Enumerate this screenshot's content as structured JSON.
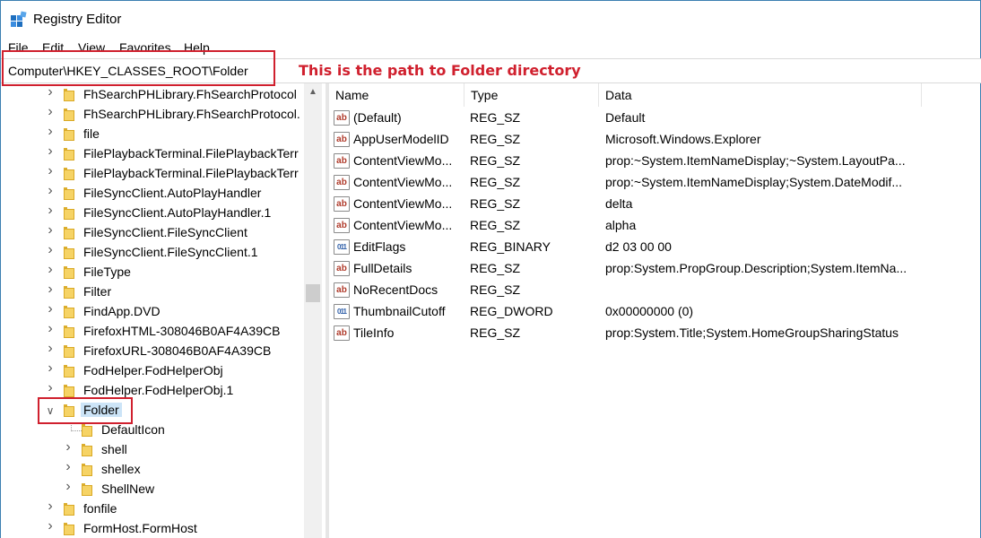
{
  "window": {
    "title": "Registry Editor"
  },
  "menu": [
    "File",
    "Edit",
    "View",
    "Favorites",
    "Help"
  ],
  "address": {
    "path": "Computer\\HKEY_CLASSES_ROOT\\Folder"
  },
  "annotation": "This is the path to Folder directory",
  "tree": [
    {
      "label": "FhSearchPHLibrary.FhSearchProtocol",
      "expanded": false,
      "level": 0
    },
    {
      "label": "FhSearchPHLibrary.FhSearchProtocol.",
      "expanded": false,
      "level": 0
    },
    {
      "label": "file",
      "expanded": false,
      "level": 0
    },
    {
      "label": "FilePlaybackTerminal.FilePlaybackTerr",
      "expanded": false,
      "level": 0
    },
    {
      "label": "FilePlaybackTerminal.FilePlaybackTerr",
      "expanded": false,
      "level": 0
    },
    {
      "label": "FileSyncClient.AutoPlayHandler",
      "expanded": false,
      "level": 0
    },
    {
      "label": "FileSyncClient.AutoPlayHandler.1",
      "expanded": false,
      "level": 0
    },
    {
      "label": "FileSyncClient.FileSyncClient",
      "expanded": false,
      "level": 0
    },
    {
      "label": "FileSyncClient.FileSyncClient.1",
      "expanded": false,
      "level": 0
    },
    {
      "label": "FileType",
      "expanded": false,
      "level": 0
    },
    {
      "label": "Filter",
      "expanded": false,
      "level": 0
    },
    {
      "label": "FindApp.DVD",
      "expanded": false,
      "level": 0
    },
    {
      "label": "FirefoxHTML-308046B0AF4A39CB",
      "expanded": false,
      "level": 0
    },
    {
      "label": "FirefoxURL-308046B0AF4A39CB",
      "expanded": false,
      "level": 0
    },
    {
      "label": "FodHelper.FodHelperObj",
      "expanded": false,
      "level": 0
    },
    {
      "label": "FodHelper.FodHelperObj.1",
      "expanded": false,
      "level": 0
    },
    {
      "label": "Folder",
      "expanded": true,
      "level": 0,
      "selected": true
    },
    {
      "label": "DefaultIcon",
      "expanded": null,
      "level": 1
    },
    {
      "label": "shell",
      "expanded": false,
      "level": 1
    },
    {
      "label": "shellex",
      "expanded": false,
      "level": 1
    },
    {
      "label": "ShellNew",
      "expanded": false,
      "level": 1
    },
    {
      "label": "fonfile",
      "expanded": false,
      "level": 0
    },
    {
      "label": "FormHost.FormHost",
      "expanded": false,
      "level": 0
    }
  ],
  "columns": {
    "name": "Name",
    "type": "Type",
    "data": "Data"
  },
  "values": [
    {
      "icon": "string-value-icon",
      "name": "(Default)",
      "type": "REG_SZ",
      "data": "Default"
    },
    {
      "icon": "string-value-icon",
      "name": "AppUserModelID",
      "type": "REG_SZ",
      "data": "Microsoft.Windows.Explorer"
    },
    {
      "icon": "string-value-icon",
      "name": "ContentViewMo...",
      "type": "REG_SZ",
      "data": "prop:~System.ItemNameDisplay;~System.LayoutPa..."
    },
    {
      "icon": "string-value-icon",
      "name": "ContentViewMo...",
      "type": "REG_SZ",
      "data": "prop:~System.ItemNameDisplay;System.DateModif..."
    },
    {
      "icon": "string-value-icon",
      "name": "ContentViewMo...",
      "type": "REG_SZ",
      "data": "delta"
    },
    {
      "icon": "string-value-icon",
      "name": "ContentViewMo...",
      "type": "REG_SZ",
      "data": "alpha"
    },
    {
      "icon": "binary-value-icon",
      "name": "EditFlags",
      "type": "REG_BINARY",
      "data": "d2 03 00 00"
    },
    {
      "icon": "string-value-icon",
      "name": "FullDetails",
      "type": "REG_SZ",
      "data": "prop:System.PropGroup.Description;System.ItemNa..."
    },
    {
      "icon": "string-value-icon",
      "name": "NoRecentDocs",
      "type": "REG_SZ",
      "data": ""
    },
    {
      "icon": "binary-value-icon",
      "name": "ThumbnailCutoff",
      "type": "REG_DWORD",
      "data": "0x00000000 (0)"
    },
    {
      "icon": "string-value-icon",
      "name": "TileInfo",
      "type": "REG_SZ",
      "data": "prop:System.Title;System.HomeGroupSharingStatus"
    }
  ],
  "colors": {
    "annotation": "#d0202e",
    "selection": "#cce4f7",
    "folder": "#f6d365"
  }
}
